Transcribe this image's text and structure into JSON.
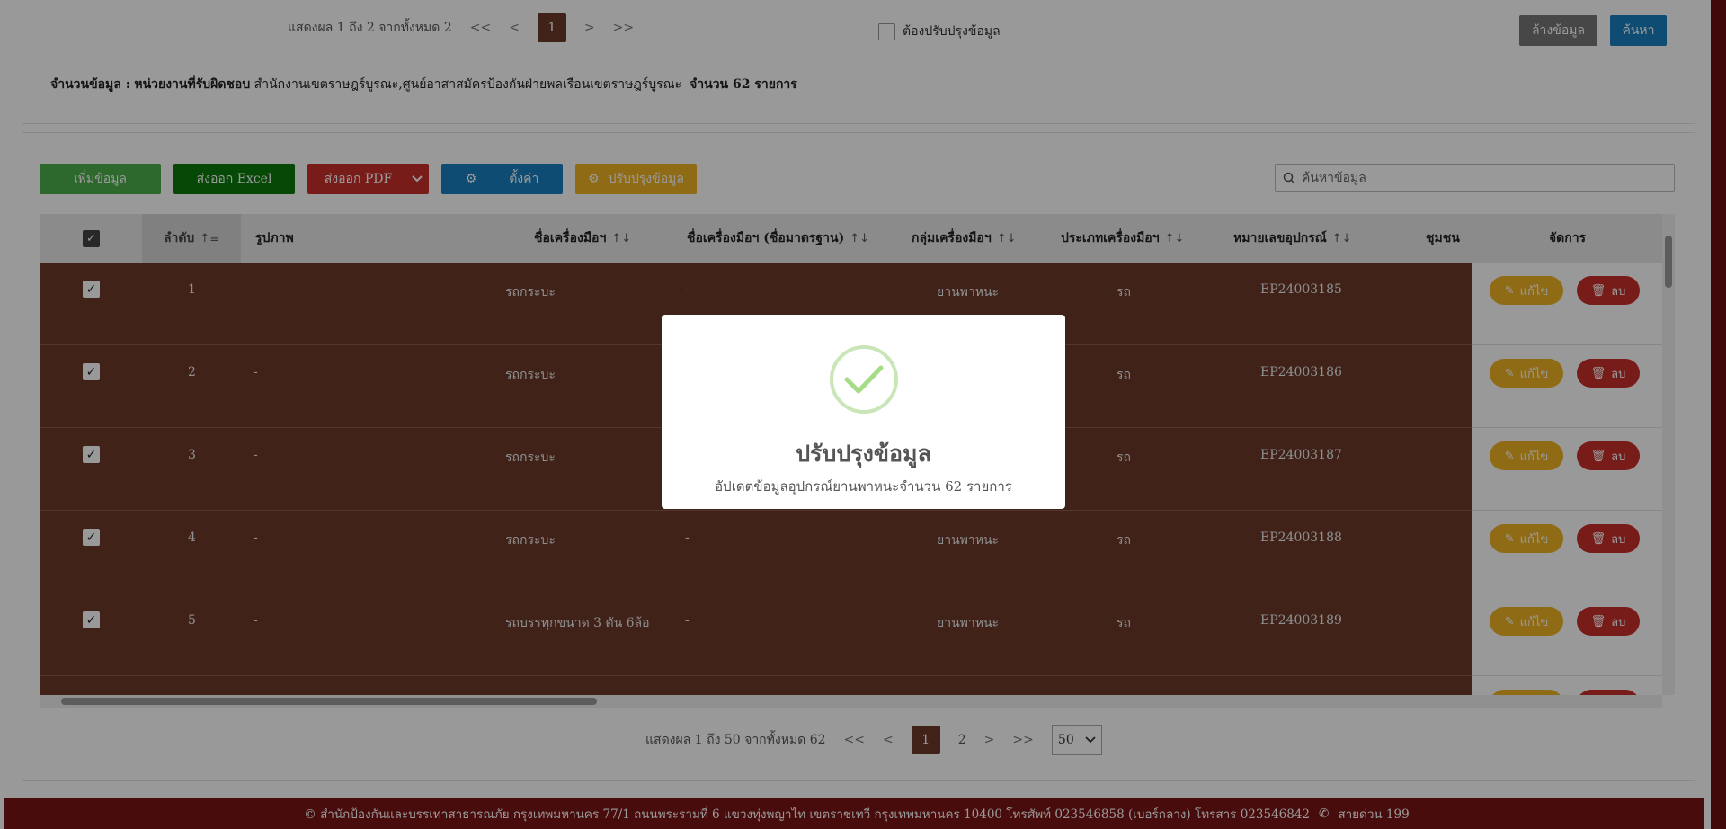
{
  "top_pager": {
    "summary": "แสดงผล 1 ถึง 2 จากทั้งหมด 2",
    "first": "<<",
    "prev": "<",
    "current": "1",
    "next": ">",
    "last": ">>"
  },
  "needs_update_checkbox": {
    "label": "ต้องปรับปรุงข้อมูล"
  },
  "filter_buttons": {
    "clear": "ล้างข้อมูล",
    "search": "ค้นหา"
  },
  "info": {
    "count_label": "จำนวนข้อมูล :",
    "dept_label": "หน่วยงานที่รับผิดชอบ",
    "dept_value": "สำนักงานเขตราษฎร์บูรณะ,ศูนย์อาสาสมัครป้องกันฝ่ายพลเรือนเขตราษฎร์บูรณะ",
    "total": "จำนวน 62 รายการ"
  },
  "toolbar": {
    "add": "เพิ่มข้อมูล",
    "excel": "ส่งออก Excel",
    "pdf": "ส่งออก PDF",
    "settings": "ตั้งค่า",
    "update": "ปรับปรุงข้อมูล",
    "search_placeholder": "ค้นหาข้อมูล"
  },
  "table": {
    "headers": [
      "ลำดับ",
      "รูปภาพ",
      "ชื่อเครื่องมือฯ",
      "ชื่อเครื่องมือฯ (ชื่อมาตรฐาน)",
      "กลุ่มเครื่องมือฯ",
      "ประเภทเครื่องมือฯ",
      "หมายเลขอุปกรณ์",
      "ชุมชน",
      "จัดการ"
    ],
    "rows": [
      {
        "no": "1",
        "image": "-",
        "name": "รถกระบะ",
        "std": "-",
        "group": "ยานพาหนะ",
        "type": "รถ",
        "serial": "EP24003185"
      },
      {
        "no": "2",
        "image": "-",
        "name": "รถกระบะ",
        "std": "",
        "group": "",
        "type": "รถ",
        "serial": "EP24003186"
      },
      {
        "no": "3",
        "image": "-",
        "name": "รถกระบะ",
        "std": "",
        "group": "",
        "type": "รถ",
        "serial": "EP24003187"
      },
      {
        "no": "4",
        "image": "-",
        "name": "รถกระบะ",
        "std": "-",
        "group": "ยานพาหนะ",
        "type": "รถ",
        "serial": "EP24003188"
      },
      {
        "no": "5",
        "image": "-",
        "name": "รถบรรทุกขนาด 3 ตัน 6ล้อ",
        "std": "-",
        "group": "ยานพาหนะ",
        "type": "รถ",
        "serial": "EP24003189"
      }
    ],
    "edit_label": "แก้ไข",
    "delete_label": "ลบ"
  },
  "bottom_pager": {
    "summary": "แสดงผล 1 ถึง 50 จากทั้งหมด 62",
    "first": "<<",
    "prev": "<",
    "page1": "1",
    "page2": "2",
    "next": ">",
    "last": ">>",
    "page_size": "50"
  },
  "footer": {
    "address": "© สำนักป้องกันและบรรเทาสาธารณภัย กรุงเทพมหานคร 77/1 ถนนพระรามที่ 6 แขวงทุ่งพญาไท เขตราชเทวี กรุงเทพมหานคร 10400 โทรศัพท์ 023546858 (เบอร์กลาง) โทรสาร 023546842",
    "hotline": "สายด่วน 199"
  },
  "modal": {
    "title": "ปรับปรุงข้อมูล",
    "message": "อัปเดตข้อมูลอุปกรณ์ยานพาหนะจำนวน 62 รายการ"
  },
  "colors": {
    "brand": "#7a1414",
    "active_page": "#6b3a2a",
    "add": "#4cae4c",
    "excel": "#0b7a0b",
    "pdf": "#c9302c",
    "settings": "#1a7fc1",
    "update": "#f0b323",
    "edit": "#f0b323",
    "delete": "#c9302c"
  }
}
